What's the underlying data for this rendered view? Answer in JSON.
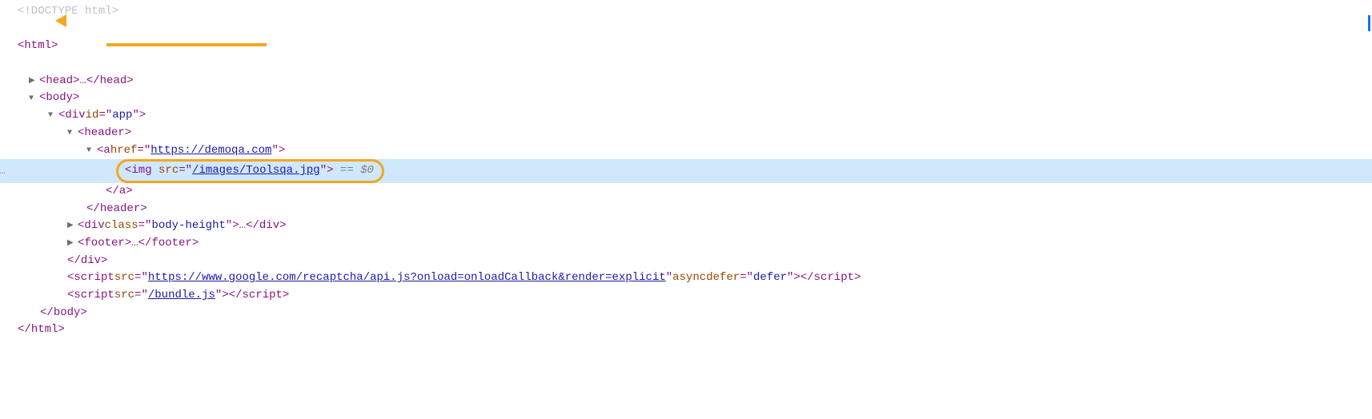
{
  "dom": {
    "doctype": "<!DOCTYPE html>",
    "html_open": "html",
    "html_close": "html",
    "head_open": "head",
    "head_ellipsis": "…",
    "head_close": "head",
    "body_open": "body",
    "body_close": "body",
    "div_app": {
      "tag": "div",
      "attr_id_name": "id",
      "attr_id_val": "app",
      "close": "div"
    },
    "header": {
      "open": "header",
      "close": "header"
    },
    "anchor": {
      "tag": "a",
      "href_name": "href",
      "href_val": "https://demoqa.com",
      "close": "a"
    },
    "img": {
      "tag": "img",
      "src_name": "src",
      "src_val": "/images/Toolsqa.jpg"
    },
    "selected_ref": " == $0",
    "body_height": {
      "tag": "div",
      "class_name": "class",
      "class_val": "body-height",
      "ellipsis": "…",
      "close": "div"
    },
    "footer": {
      "open": "footer",
      "ellipsis": "…",
      "close": "footer"
    },
    "script1": {
      "tag": "script",
      "src_name": "src",
      "src_val": "https://www.google.com/recaptcha/api.js?onload=onloadCallback&render=explicit",
      "async": "async",
      "defer_name": "defer",
      "defer_val": "defer",
      "close": "script"
    },
    "script2": {
      "tag": "script",
      "src_name": "src",
      "src_val": "/bundle.js",
      "close": "script"
    }
  },
  "left_ellipsis": "…"
}
